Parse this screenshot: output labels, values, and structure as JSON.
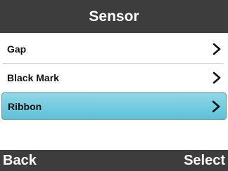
{
  "header": {
    "title": "Sensor"
  },
  "menu": {
    "items": [
      {
        "label": "Gap",
        "icon": "chevron-right-icon",
        "selected": false
      },
      {
        "label": "Black Mark",
        "icon": "chevron-right-icon",
        "selected": false
      },
      {
        "label": "Ribbon",
        "icon": "chevron-right-icon",
        "selected": true
      }
    ]
  },
  "softkeys": {
    "left_label": "Back",
    "right_label": "Select"
  },
  "colors": {
    "bar_background": "#3d3d3d",
    "selection_highlight": "#5cc2d8",
    "text": "#111111"
  }
}
